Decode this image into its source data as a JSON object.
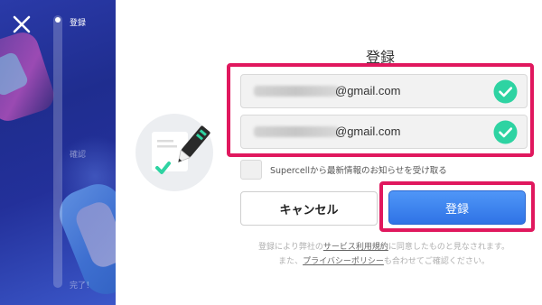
{
  "progress": {
    "steps": [
      {
        "label": "登録",
        "active": true
      },
      {
        "label": "確認",
        "active": false
      },
      {
        "label": "完了！",
        "active": false
      }
    ]
  },
  "form": {
    "title": "登録",
    "email_fields": [
      {
        "value": "@gmail.com",
        "verified": true
      },
      {
        "value": "@gmail.com",
        "verified": true
      }
    ],
    "newsletter_label": "Supercellから最新情報のお知らせを受け取る",
    "newsletter_checked": false,
    "cancel_label": "キャンセル",
    "register_label": "登録"
  },
  "terms": {
    "line1_pre": "登録により弊社の",
    "line1_link": "サービス利用規約",
    "line1_post": "に同意したものと見なされます。",
    "line2_pre": "また、",
    "line2_link": "プライバシーポリシー",
    "line2_post": "も合わせてご確認ください。"
  },
  "colors": {
    "accent_blue": "#3580ee",
    "check_green": "#2ed3a2",
    "highlight": "#e0185e"
  }
}
